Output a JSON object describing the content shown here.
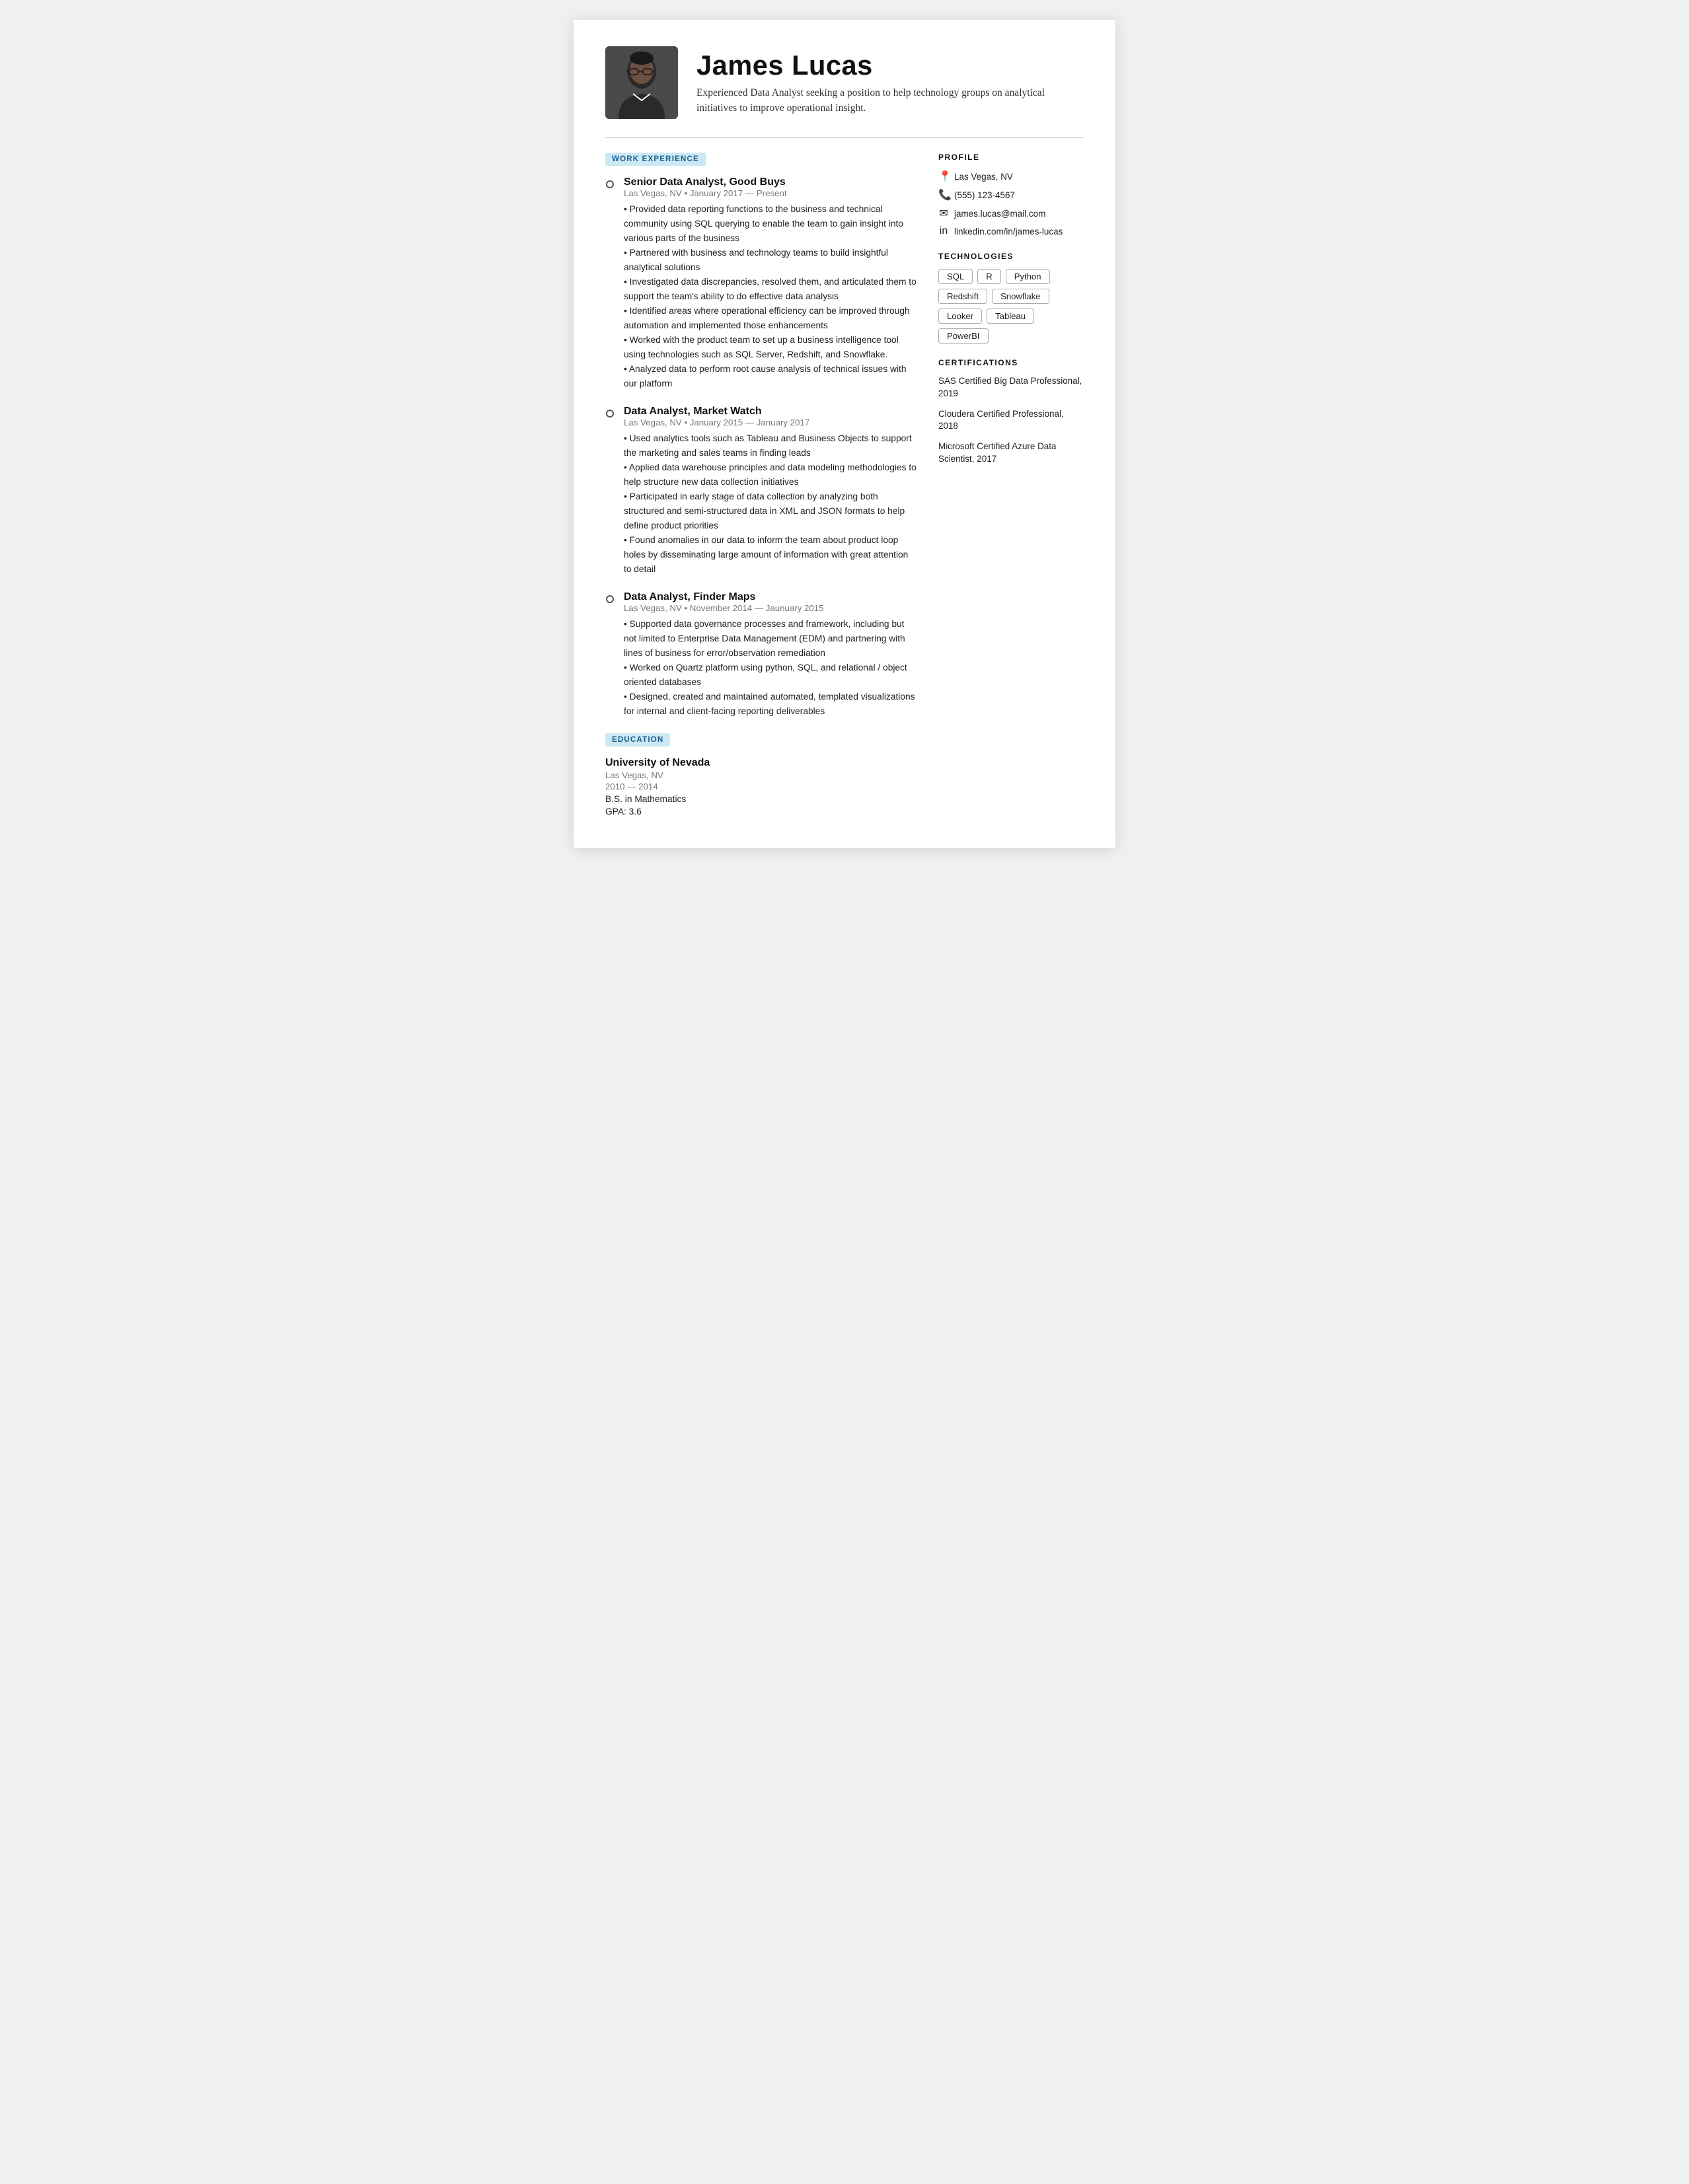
{
  "header": {
    "name": "James Lucas",
    "tagline": "Experienced Data Analyst seeking a position to help technology groups on analytical initiatives to improve operational insight."
  },
  "left": {
    "work_label": "WORK EXPERIENCE",
    "jobs": [
      {
        "title": "Senior Data Analyst, Good Buys",
        "meta": "Las Vegas, NV • January 2017 — Present",
        "desc": "• Provided data reporting functions to the business and technical community using SQL querying to enable the team to gain insight into various parts of the business\n• Partnered with business and technology teams to build insightful analytical solutions\n• Investigated data discrepancies, resolved them, and articulated them to support the team's ability to do effective data analysis\n• Identified areas where operational efficiency can be improved through automation and implemented those enhancements\n• Worked with the product team to set up a business intelligence tool using technologies such as SQL Server, Redshift, and Snowflake.\n• Analyzed data to perform root cause analysis of technical issues with our platform"
      },
      {
        "title": "Data Analyst, Market Watch",
        "meta": "Las Vegas, NV • January 2015 — January 2017",
        "desc": "• Used analytics tools such as Tableau and Business Objects to support the marketing and sales teams in finding leads\n• Applied data warehouse principles and data modeling methodologies to help structure new data collection initiatives\n• Participated in early stage of data collection by analyzing both structured and semi-structured data in XML and JSON formats to help define product priorities\n• Found anomalies in our data to inform the team about product loop holes by disseminating large amount of information with great attention to detail"
      },
      {
        "title": "Data Analyst, Finder Maps",
        "meta": "Las Vegas, NV • November 2014 — Jaunuary 2015",
        "desc": "• Supported data governance processes and framework, including but not limited to Enterprise Data Management (EDM) and partnering with lines of business for error/observation remediation\n• Worked on Quartz platform using python, SQL, and relational / object oriented databases\n• Designed, created and maintained automated, templated visualizations for internal and client-facing reporting deliverables"
      }
    ],
    "education_label": "EDUCATION",
    "education": {
      "school": "University of Nevada",
      "location": "Las Vegas, NV",
      "years": "2010 — 2014",
      "degree": "B.S. in Mathematics",
      "gpa": "GPA: 3.6"
    }
  },
  "right": {
    "profile_label": "PROFILE",
    "location": "Las Vegas, NV",
    "phone": "(555) 123-4567",
    "email": "james.lucas@mail.com",
    "linkedin": "linkedin.com/in/james-lucas",
    "tech_label": "TECHNOLOGIES",
    "technologies": [
      "SQL",
      "R",
      "Python",
      "Redshift",
      "Snowflake",
      "Looker",
      "Tableau",
      "PowerBI"
    ],
    "cert_label": "CERTIFICATIONS",
    "certifications": [
      "SAS Certified Big Data Professional, 2019",
      "Cloudera Certified Professional, 2018",
      "Microsoft Certified Azure Data Scientist, 2017"
    ]
  }
}
